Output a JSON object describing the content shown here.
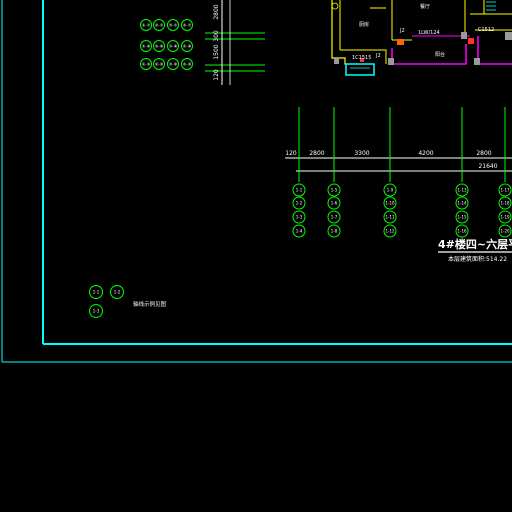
{
  "colors": {
    "background": "#000000",
    "frame": "#00ffff",
    "axis": "#00ff00",
    "dimension": "#ffffff",
    "wall_yellow": "#ffff00",
    "wall_magenta": "#ff00ff",
    "title_text": "#ffffff",
    "red_marker": "#ff3030",
    "gray_column": "#9a9a9a"
  },
  "top_left_grid": {
    "rows": [
      [
        "①-⑦",
        "②-⑦",
        "③-⑦",
        "④-⑦"
      ],
      [
        "①-⑧",
        "②-⑧",
        "③-⑧",
        "④-⑧"
      ],
      [
        "①-⑨",
        "②-⑨",
        "③-⑨",
        "④-⑨"
      ]
    ],
    "vertical_dims": [
      "2800",
      "300",
      "1500",
      "120"
    ]
  },
  "plan": {
    "room_labels": [
      "厨房",
      "餐厅",
      "阳台"
    ],
    "window_labels": [
      "J2",
      "1LW/124",
      "C1512",
      "1C1515",
      "J2"
    ]
  },
  "axes": {
    "dims": [
      "120",
      "2800",
      "3300",
      "4200",
      "2800"
    ],
    "total": "21640",
    "columns": [
      [
        "1-1",
        "1-2",
        "1-3",
        "1-4"
      ],
      [
        "1-5",
        "1-6",
        "1-7",
        "1-8"
      ],
      [
        "1-9",
        "1-10",
        "1-11",
        "1-12"
      ],
      [
        "1-13",
        "1-14",
        "1-15",
        "1-16"
      ],
      [
        "1-17",
        "1-18",
        "1-19",
        "1-20"
      ]
    ]
  },
  "title": {
    "main": "4#楼四~六层平",
    "sub": "本层建筑面积:514.22"
  },
  "legend": {
    "bubbles": [
      "1-1",
      "1-2",
      "1-3"
    ],
    "note": "轴线示例见图"
  }
}
